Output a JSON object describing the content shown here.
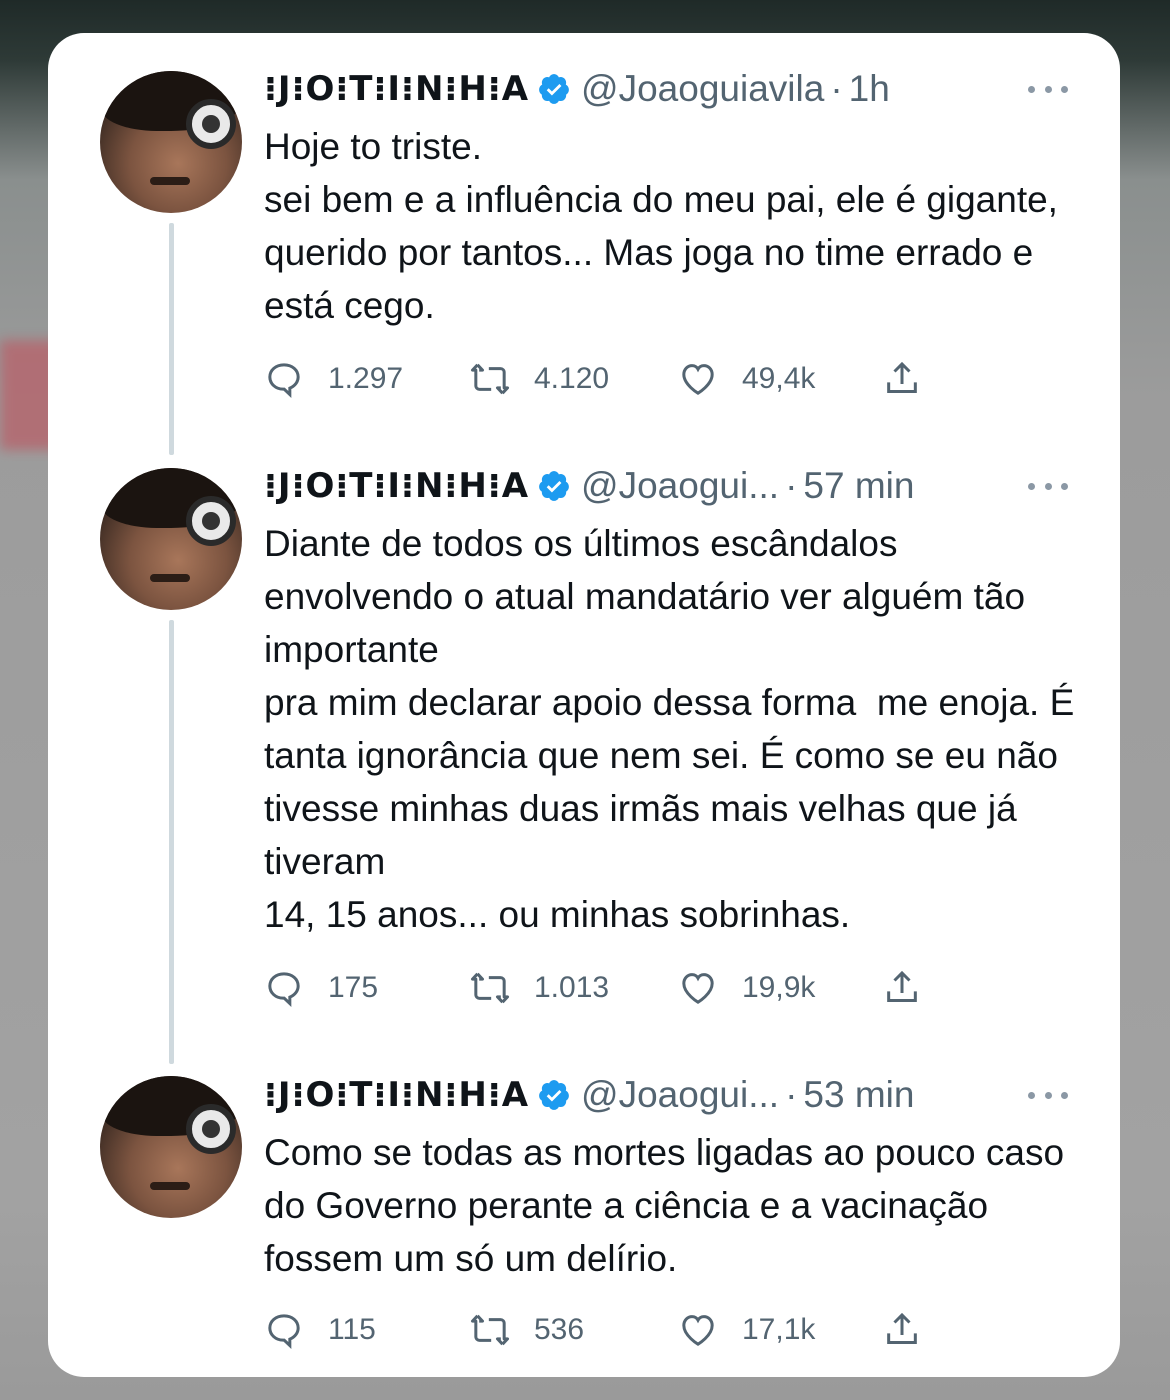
{
  "colors": {
    "card": "#ffffff",
    "text": "#0f1419",
    "secondary": "#536471",
    "verified": "#1d9bf0"
  },
  "account": {
    "display_name": "⁝J⁝O⁝T⁝I⁝N⁝H⁝A",
    "verified_icon": "verified-badge-icon"
  },
  "tweets": [
    {
      "handle": "@Joaoguiavila",
      "time": "1h",
      "text": "Hoje to triste.\nsei bem e a influência do meu pai, ele é gigante, querido por tantos... Mas joga no time errado e está cego.",
      "replies": "1.297",
      "retweets": "4.120",
      "likes": "49,4k"
    },
    {
      "handle": "@Joaogui...",
      "time": "57 min",
      "text": "Diante de todos os últimos escândalos envolvendo o atual mandatário ver alguém tão importante\npra mim declarar apoio dessa forma  me enoja. É tanta ignorância que nem sei. É como se eu não tivesse minhas duas irmãs mais velhas que já tiveram\n14, 15 anos... ou minhas sobrinhas.",
      "replies": "175",
      "retweets": "1.013",
      "likes": "19,9k"
    },
    {
      "handle": "@Joaogui...",
      "time": "53 min",
      "text": "Como se todas as mortes ligadas ao pouco caso do Governo perante a ciência e a vacinação fossem um só um delírio.",
      "replies": "115",
      "retweets": "536",
      "likes": "17,1k"
    }
  ]
}
